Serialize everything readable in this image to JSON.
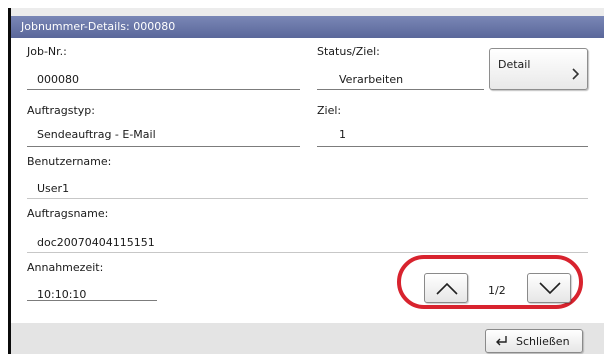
{
  "window": {
    "title": "Jobnummer-Details:  000080"
  },
  "fields": {
    "job_nr": {
      "label": "Job-Nr.:",
      "value": "000080"
    },
    "status": {
      "label": "Status/Ziel:",
      "value": "Verarbeiten"
    },
    "auftragstyp": {
      "label": "Auftragstyp:",
      "value": "Sendeauftrag - E-Mail"
    },
    "ziel": {
      "label": "Ziel:",
      "value": "1"
    },
    "benutzername": {
      "label": "Benutzername:",
      "value": "User1"
    },
    "auftragsname": {
      "label": "Auftragsname:",
      "value": "doc20070404115151"
    },
    "annahmezeit": {
      "label": "Annahmezeit:",
      "value": "10:10:10"
    }
  },
  "buttons": {
    "detail": "Detail",
    "close": "Schließen"
  },
  "pager": {
    "indicator": "1/2"
  },
  "icons": {
    "detail": "chevron-right-icon",
    "up": "chevron-up-icon",
    "down": "chevron-down-icon",
    "close": "return-arrow-icon"
  },
  "colors": {
    "title_bar": "#6a76a8",
    "highlight_ring": "#d8232e"
  }
}
